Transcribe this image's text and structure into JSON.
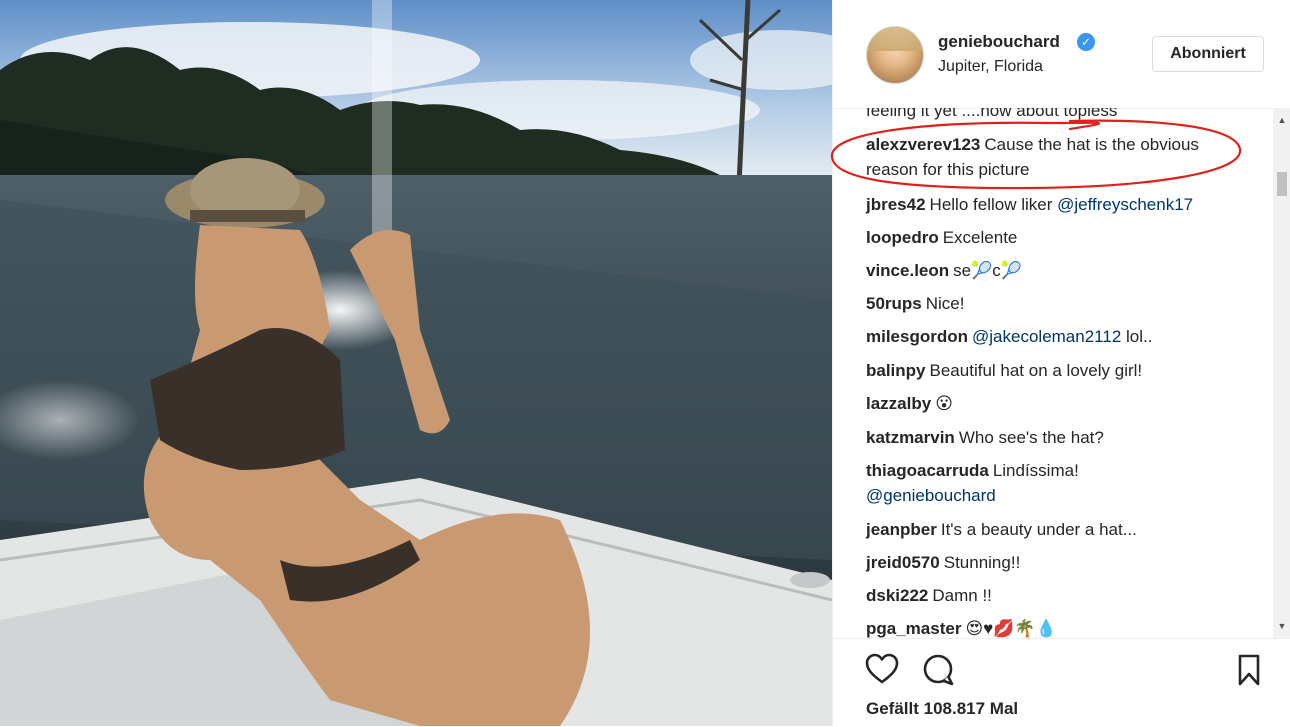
{
  "post": {
    "username": "geniebouchard",
    "verified_mark": "✓",
    "location": "Jupiter, Florida",
    "follow_label": "Abonniert"
  },
  "comments": {
    "cutoff": "feeling it yet ....how about topless",
    "items": [
      {
        "user": "alexzverev123",
        "text": "Cause the hat is the obvious reason for this picture",
        "mention": ""
      },
      {
        "user": "jbres42",
        "text": "Hello fellow liker ",
        "mention": "@jeffreyschenk17"
      },
      {
        "user": "loopedro",
        "text": "Excelente",
        "mention": ""
      },
      {
        "user": "vince.leon",
        "text": "se🎾c🎾",
        "mention": ""
      },
      {
        "user": "50rups",
        "text": "Nice!",
        "mention": ""
      },
      {
        "user": "milesgordon",
        "text": " lol..",
        "mention": "@jakecoleman2112"
      },
      {
        "user": "balinpy",
        "text": "Beautiful hat on a lovely girl!",
        "mention": ""
      },
      {
        "user": "lazzalby",
        "text": "😮",
        "mention": ""
      },
      {
        "user": "katzmarvin",
        "text": "Who see's the hat?",
        "mention": ""
      },
      {
        "user": "thiagoacarruda",
        "text": "Lindíssima!",
        "mention": "@geniebouchard"
      },
      {
        "user": "jeanpber",
        "text": "It's a beauty under a hat...",
        "mention": ""
      },
      {
        "user": "jreid0570",
        "text": "Stunning!!",
        "mention": ""
      },
      {
        "user": "dski222",
        "text": "Damn !!",
        "mention": ""
      },
      {
        "user": "pga_master",
        "text": "😍♥💋🌴💧",
        "mention": ""
      }
    ]
  },
  "actions": {
    "like_icon": "heart-icon",
    "comment_icon": "speech-bubble-icon",
    "save_icon": "bookmark-icon",
    "likes_text": "Gefällt 108.817 Mal"
  },
  "colors": {
    "verified": "#3897f0",
    "mention": "#003569",
    "annotation_circle": "#e0201b"
  }
}
